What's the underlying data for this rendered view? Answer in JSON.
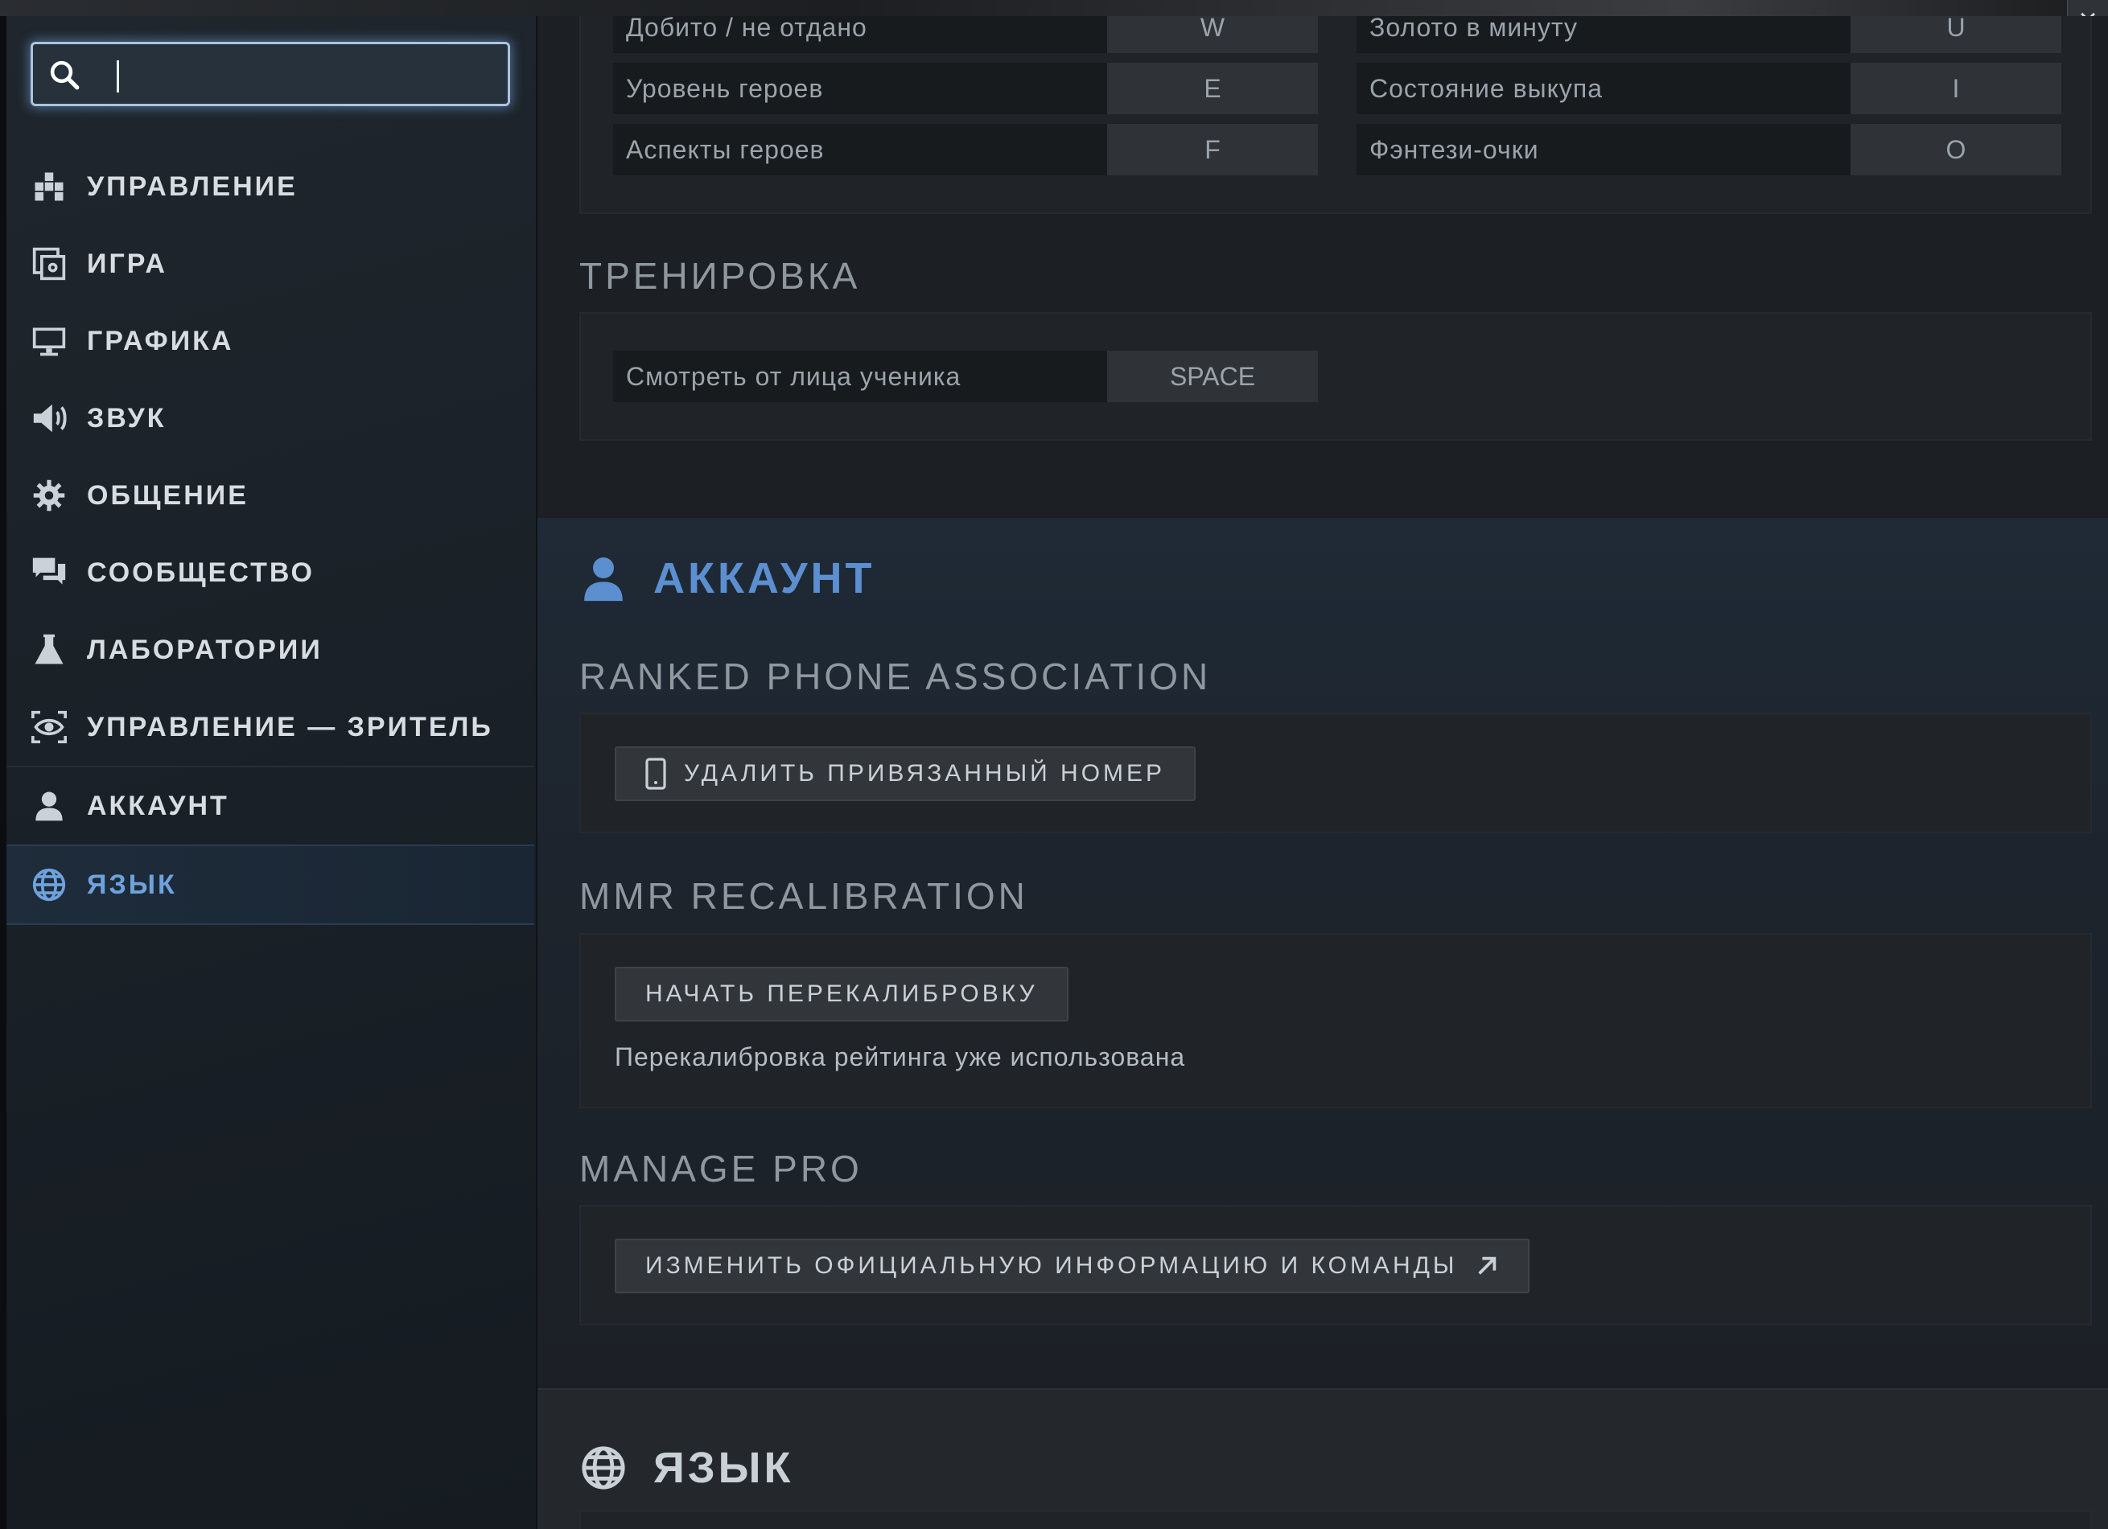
{
  "window": {
    "close_label": "×"
  },
  "search": {
    "value": "",
    "placeholder": ""
  },
  "sidebar": {
    "items": [
      {
        "label": "УПРАВЛЕНИЕ",
        "icon": "controls-icon"
      },
      {
        "label": "ИГРА",
        "icon": "game-settings-icon"
      },
      {
        "label": "ГРАФИКА",
        "icon": "monitor-icon"
      },
      {
        "label": "ЗВУК",
        "icon": "speaker-icon"
      },
      {
        "label": "ОБЩЕНИЕ",
        "icon": "gear-icon"
      },
      {
        "label": "СООБЩЕСТВО",
        "icon": "chat-bubbles-icon"
      },
      {
        "label": "ЛАБОРАТОРИИ",
        "icon": "flask-icon"
      },
      {
        "label": "УПРАВЛЕНИЕ — ЗРИТЕЛЬ",
        "icon": "eye-icon"
      },
      {
        "label": "АККАУНТ",
        "icon": "user-icon"
      },
      {
        "label": "ЯЗЫК",
        "icon": "globe-icon",
        "active": true
      }
    ]
  },
  "keybinds": {
    "rows": [
      {
        "left_name": "Добито / не отдано",
        "left_key": "W",
        "right_name": "Золото в минуту",
        "right_key": "U"
      },
      {
        "left_name": "Уровень героев",
        "left_key": "E",
        "right_name": "Состояние выкупа",
        "right_key": "I"
      },
      {
        "left_name": "Аспекты героев",
        "left_key": "F",
        "right_name": "Фэнтези-очки",
        "right_key": "O"
      }
    ]
  },
  "training": {
    "title": "ТРЕНИРОВКА",
    "row": {
      "name": "Смотреть от лица ученика",
      "key": "SPACE"
    }
  },
  "account": {
    "heading": "АККАУНТ",
    "ranked_phone": {
      "title": "RANKED PHONE ASSOCIATION",
      "button": "УДАЛИТЬ ПРИВЯЗАННЫЙ НОМЕР"
    },
    "mmr": {
      "title": "MMR RECALIBRATION",
      "button": "НАЧАТЬ ПЕРЕКАЛИБРОВКУ",
      "note": "Перекалибровка рейтинга уже использована"
    },
    "manage_pro": {
      "title": "MANAGE PRO",
      "button": "ИЗМЕНИТЬ ОФИЦИАЛЬНУЮ ИНФОРМАЦИЮ И КОМАНДЫ"
    }
  },
  "language": {
    "heading": "ЯЗЫК"
  },
  "colors": {
    "accent_blue": "#5b8fd0",
    "active_nav": "#6ea2dc",
    "text_primary": "#d7dde3",
    "text_muted": "#9ba3ab"
  }
}
